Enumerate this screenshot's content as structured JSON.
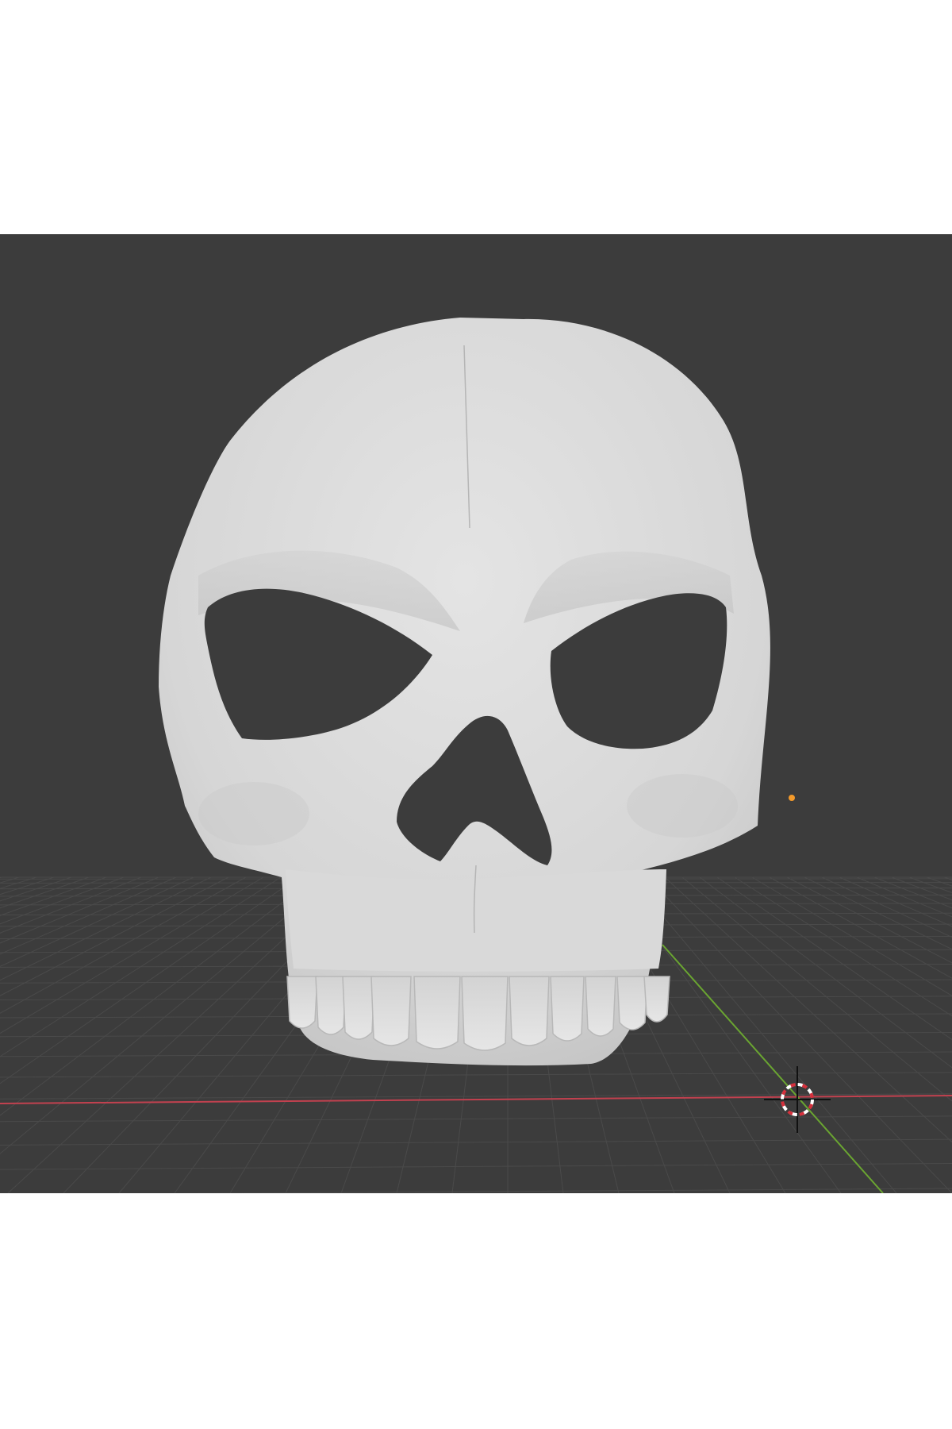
{
  "app": {
    "name": "3D viewport",
    "mode": "object-view"
  },
  "viewport": {
    "background_color": "#3c3c3c",
    "grid_color": "#4a4a4a",
    "x_axis_color": "#c2414f",
    "y_axis_color": "#6aa531"
  },
  "scene": {
    "model_icon": "skull-mask-model",
    "model_color": "#dcdcdc",
    "light_icon": "light-object-dot",
    "light_color": "#f39a2b",
    "cursor_icon": "3d-cursor-icon"
  }
}
